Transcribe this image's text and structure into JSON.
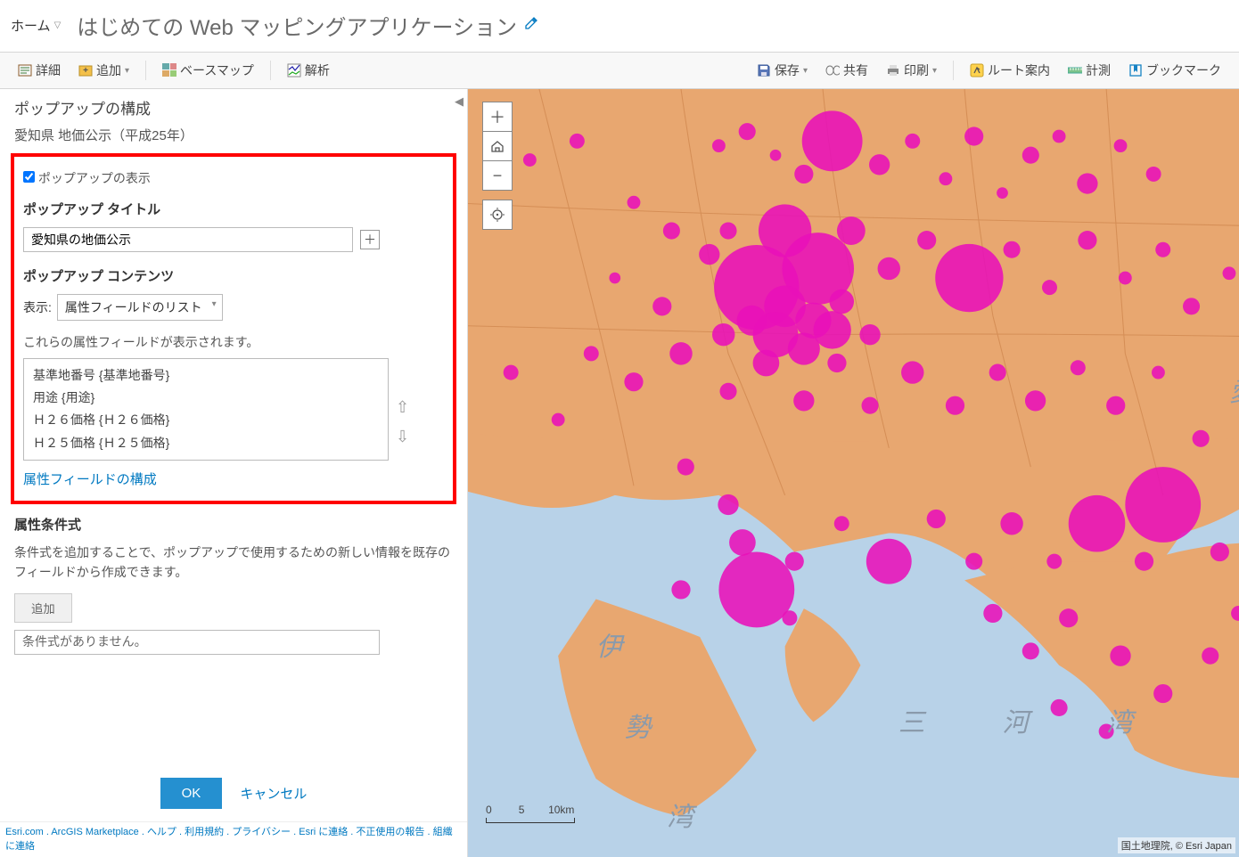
{
  "topbar": {
    "home": "ホーム",
    "title": "はじめての Web マッピングアプリケーション"
  },
  "toolbar": {
    "details": "詳細",
    "add": "追加",
    "basemap": "ベースマップ",
    "analysis": "解析",
    "save": "保存",
    "share": "共有",
    "print": "印刷",
    "route": "ルート案内",
    "measure": "計測",
    "bookmark": "ブックマーク"
  },
  "panel": {
    "heading": "ポップアップの構成",
    "subheading": "愛知県 地価公示（平成25年）",
    "show_popup": "ポップアップの表示",
    "title_section": "ポップアップ タイトル",
    "title_value": "愛知県の地価公示",
    "content_section": "ポップアップ コンテンツ",
    "display_label": "表示:",
    "display_value": "属性フィールドのリスト",
    "desc_line": "これらの属性フィールドが表示されます。",
    "fields": [
      "基準地番号 {基準地番号}",
      "用途 {用途}",
      "Ｈ２６価格 {Ｈ２６価格}",
      "Ｈ２５価格 {Ｈ２５価格}"
    ],
    "config_link": "属性フィールドの構成",
    "cond_title": "属性条件式",
    "cond_desc": "条件式を追加することで、ポップアップで使用するための新しい情報を既存のフィールドから作成できます。",
    "add_btn": "追加",
    "cond_none": "条件式がありません。",
    "ok": "OK",
    "cancel": "キャンセル"
  },
  "footer": {
    "links": [
      "Esri.com",
      "ArcGIS Marketplace",
      "ヘルプ",
      "利用規約",
      "プライバシー",
      "Esri に連絡",
      "不正使用の報告",
      "組織に連絡"
    ]
  },
  "map": {
    "scale_min": "0",
    "scale_mid": "5",
    "scale_max": "10km",
    "attribution": "国土地理院, © Esri Japan",
    "labels": {
      "ise": "伊",
      "ise2": "勢",
      "wan": "湾",
      "mi": "三",
      "kawa": "河",
      "wan2": "湾",
      "ai": "愛"
    }
  }
}
